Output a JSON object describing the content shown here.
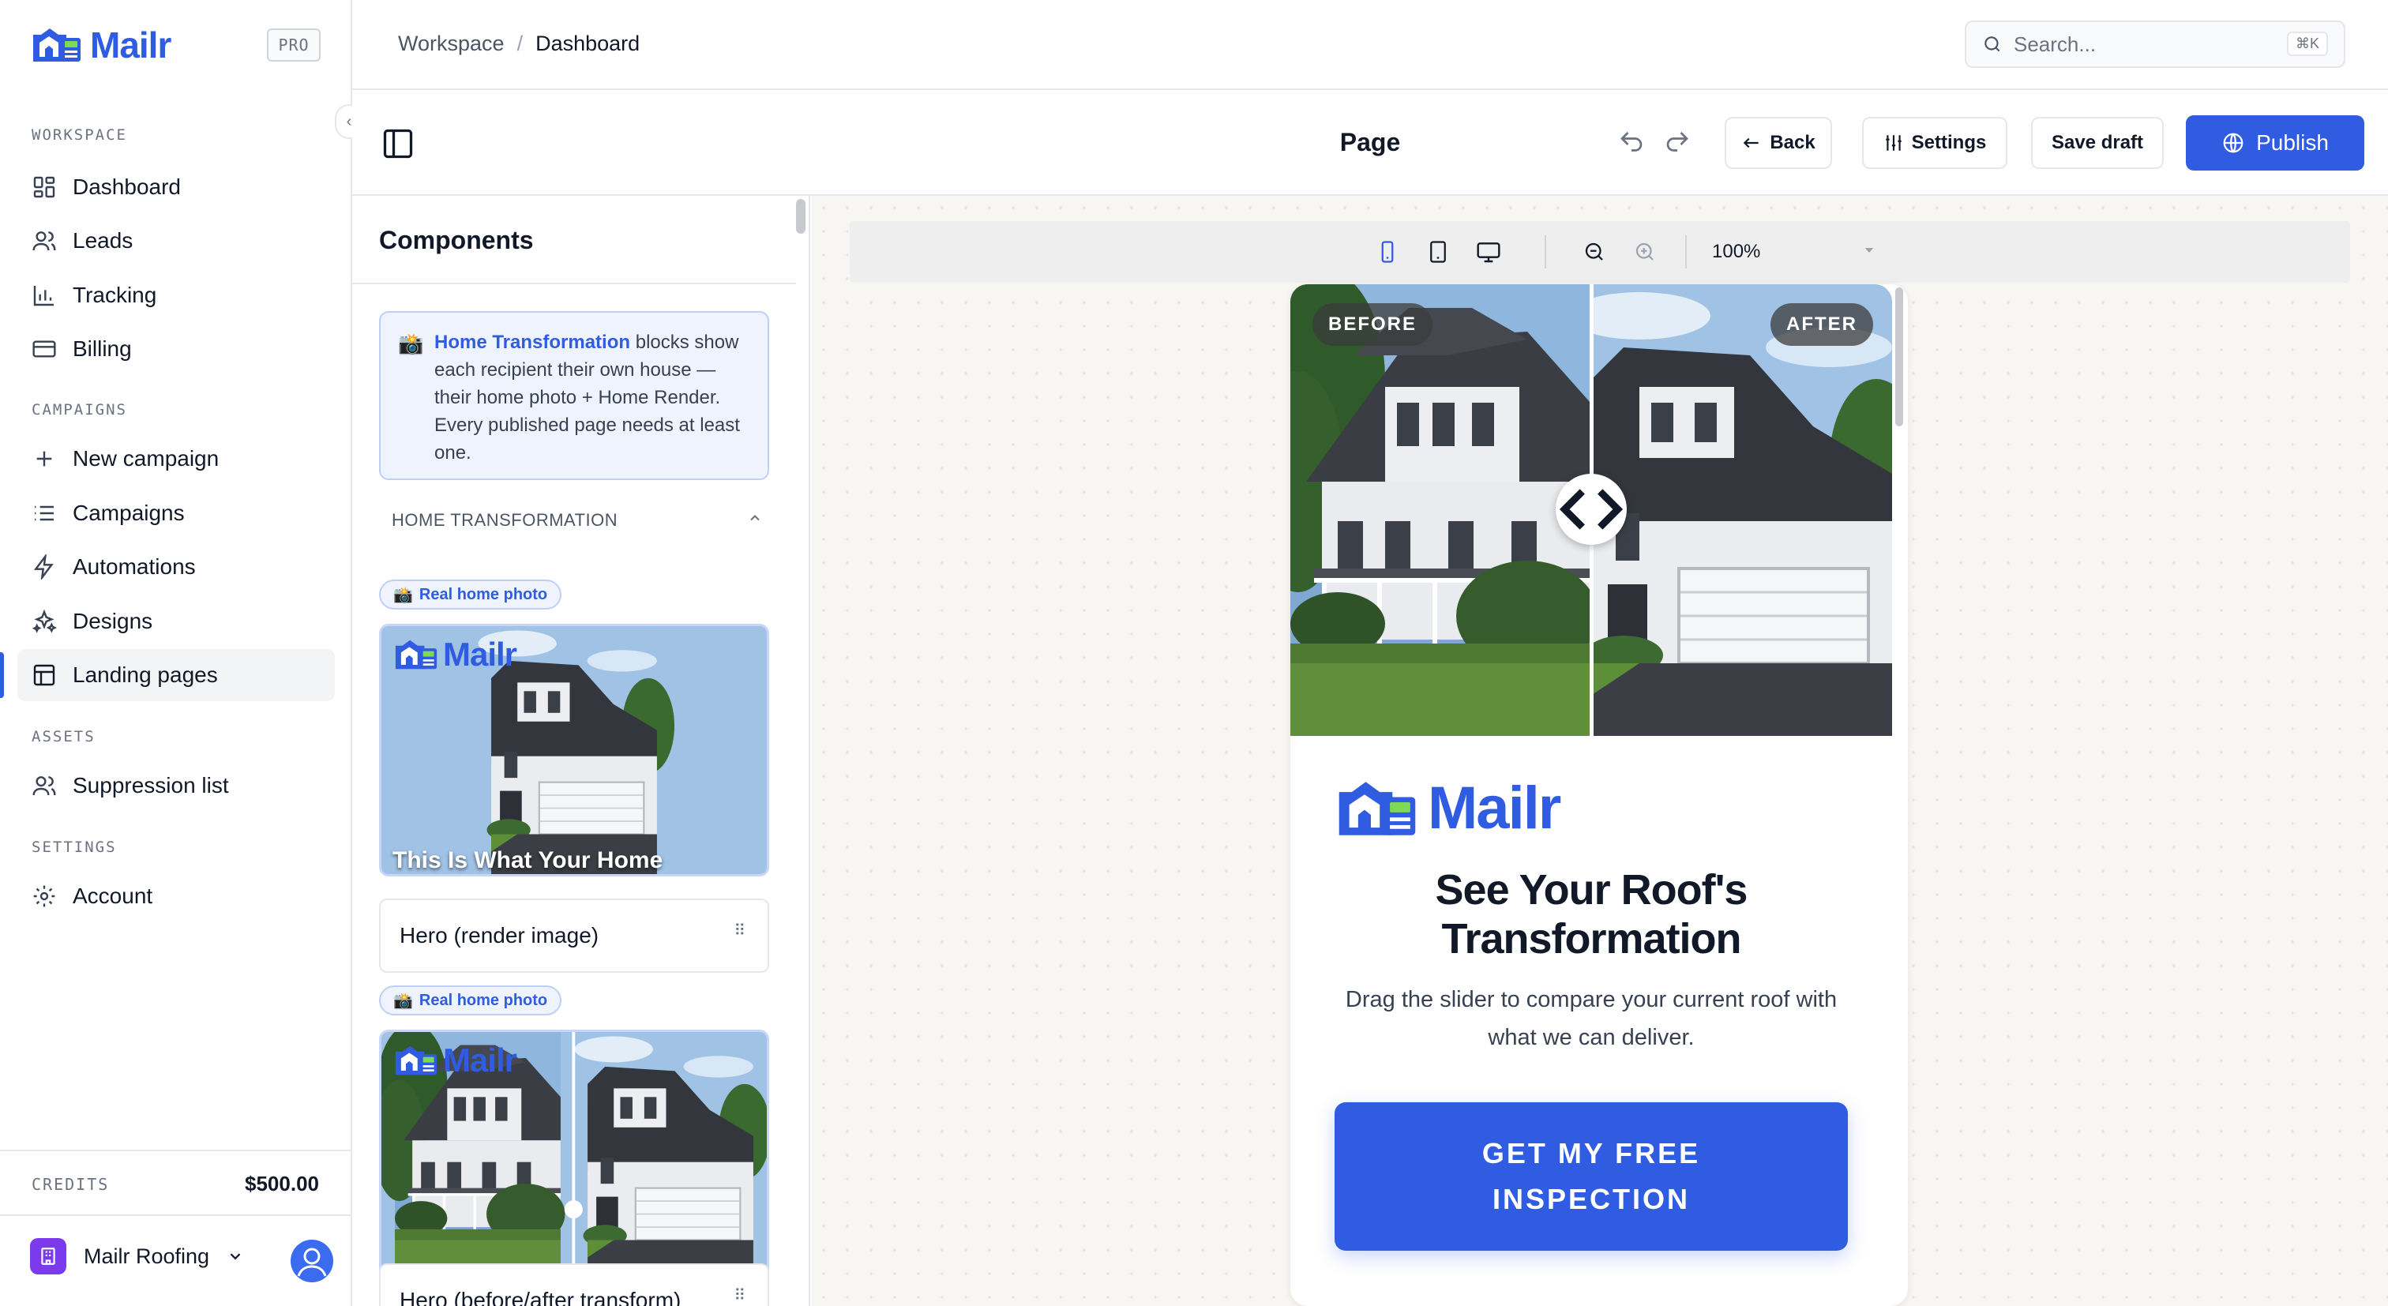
{
  "app": {
    "name": "Mailr",
    "plan_badge": "PRO"
  },
  "colors": {
    "brand": "#2f5ce0",
    "org_icon": "#7c3aed"
  },
  "sidebar": {
    "sections": {
      "workspace": "WORKSPACE",
      "campaigns": "CAMPAIGNS",
      "assets": "ASSETS",
      "settings": "SETTINGS"
    },
    "workspace_items": [
      {
        "label": "Dashboard",
        "icon": "grid-icon"
      },
      {
        "label": "Leads",
        "icon": "users-icon"
      },
      {
        "label": "Tracking",
        "icon": "bar-chart-icon"
      },
      {
        "label": "Billing",
        "icon": "credit-card-icon"
      }
    ],
    "campaign_items": [
      {
        "label": "New campaign",
        "icon": "plus-icon"
      },
      {
        "label": "Campaigns",
        "icon": "list-icon"
      },
      {
        "label": "Automations",
        "icon": "bolt-icon"
      },
      {
        "label": "Designs",
        "icon": "sparkles-icon"
      },
      {
        "label": "Landing pages",
        "icon": "layout-icon",
        "active": true
      }
    ],
    "asset_items": [
      {
        "label": "Suppression list",
        "icon": "users-icon"
      }
    ],
    "settings_items": [
      {
        "label": "Account",
        "icon": "gear-icon"
      }
    ],
    "credits": {
      "label": "CREDITS",
      "value": "$500.00"
    },
    "org": {
      "name": "Mailr Roofing"
    }
  },
  "header": {
    "breadcrumb": [
      "Workspace",
      "Dashboard"
    ],
    "search": {
      "placeholder": "Search...",
      "shortcut": "⌘K"
    }
  },
  "editor": {
    "title": "Page",
    "back_label": "Back",
    "settings_label": "Settings",
    "save_label": "Save draft",
    "publish_label": "Publish"
  },
  "components": {
    "title": "Components",
    "info": {
      "strong": "Home Transformation",
      "text": " blocks show each recipient their own house — their home photo + Home Render. Every published page needs at least one."
    },
    "group_label": "HOME TRANSFORMATION",
    "items": [
      {
        "badge": "Real home photo",
        "thumb_caption": "This Is What Your Home",
        "label": "Hero (render image)"
      },
      {
        "badge": "Real home photo",
        "label": "Hero (before/after transform)"
      }
    ]
  },
  "canvas": {
    "zoom": "100%",
    "preview": {
      "before_label": "BEFORE",
      "after_label": "AFTER",
      "headline": "See Your Roof's Transformation",
      "subtext": "Drag the slider to compare your current roof with what we can deliver.",
      "cta": "GET MY FREE INSPECTION"
    }
  }
}
